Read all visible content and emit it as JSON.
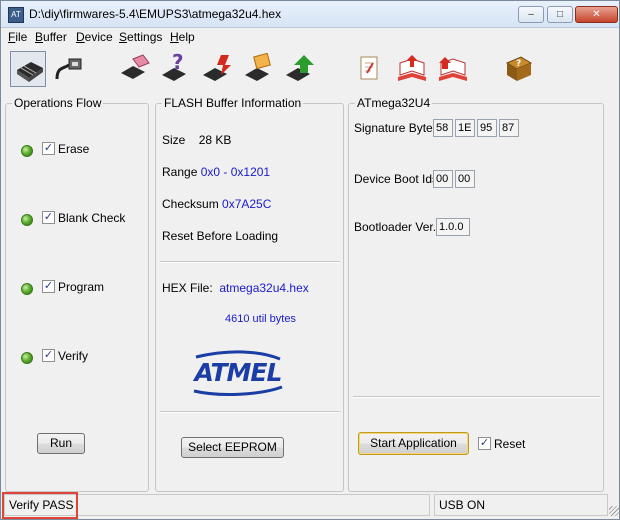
{
  "window": {
    "title": "D:\\diy\\firmwares-5.4\\EMUPS3\\atmega32u4.hex",
    "app_icon_text": "AT",
    "minimize_glyph": "–",
    "maximize_glyph": "□",
    "close_glyph": "✕"
  },
  "menu": {
    "file": "File",
    "buffer": "Buffer",
    "device": "Device",
    "settings": "Settings",
    "help": "Help"
  },
  "toolbar": {
    "icons": [
      "select-device-icon",
      "usb-connection-icon",
      "erase-device-icon",
      "blank-check-icon",
      "program-device-icon",
      "read-device-icon",
      "verify-device-icon",
      "load-hex-icon",
      "save-hex-icon",
      "edit-buffer-icon",
      "help-book-icon"
    ]
  },
  "operations": {
    "legend": "Operations Flow",
    "steps": [
      {
        "label": "Erase",
        "checked": true
      },
      {
        "label": "Blank Check",
        "checked": true
      },
      {
        "label": "Program",
        "checked": true
      },
      {
        "label": "Verify",
        "checked": true
      }
    ],
    "run_label": "Run",
    "check_glyph": "✓"
  },
  "flash": {
    "legend": "FLASH Buffer Information",
    "size_label": "Size",
    "size_value": "28 KB",
    "range_label": "Range",
    "range_value": "0x0 - 0x1201",
    "checksum_label": "Checksum",
    "checksum_value": "0x7A25C",
    "reset_before_loading": "Reset Before Loading",
    "hex_file_label": "HEX File:",
    "hex_file_value": "atmega32u4.hex",
    "util_bytes": "4610 util bytes",
    "logo_text": "ATMEL",
    "select_eeprom_label": "Select EEPROM"
  },
  "device": {
    "legend": "ATmega32U4",
    "signature_label": "Signature Bytes",
    "signature_bytes": [
      "58",
      "1E",
      "95",
      "87"
    ],
    "boot_ids_label": "Device Boot Ids",
    "boot_ids": [
      "00",
      "00"
    ],
    "bootloader_label": "Bootloader Ver.",
    "bootloader_value": "1.0.0",
    "start_app_label": "Start Application",
    "reset_label": "Reset",
    "reset_checked": true
  },
  "status": {
    "message": "Verify PASS",
    "connection": "USB ON"
  },
  "colors": {
    "accent_blue": "#1a1ad0",
    "led_green": "#5fb12f",
    "highlight_red": "#e0453a"
  }
}
